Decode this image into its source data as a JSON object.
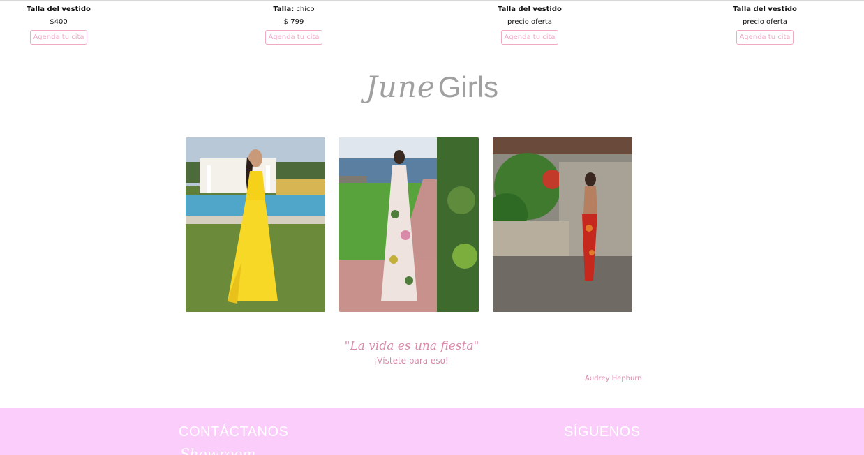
{
  "products": [
    {
      "line1_label": "Talla del vestido",
      "line1_value": "",
      "line2": "$400",
      "cta": "Agenda tu cita"
    },
    {
      "line1_label": "Talla:",
      "line1_value": " chico",
      "line2": "$ 799",
      "cta": "Agenda tu cita"
    },
    {
      "line1_label": "Talla del vestido",
      "line1_value": "",
      "line2": "precio oferta",
      "cta": "Agenda tu cita"
    },
    {
      "line1_label": "Talla del vestido",
      "line1_value": "",
      "line2": "precio oferta",
      "cta": "Agenda tu cita"
    }
  ],
  "brand": {
    "script": "June",
    "plain": "Girls"
  },
  "quote": {
    "text": "\"La vida es una fiesta\"",
    "subtext": "¡Vístete para eso!",
    "author": "Audrey Hepburn"
  },
  "footer": {
    "contact": "CONTÁCTANOS",
    "follow": "SÍGUENOS",
    "showroom": "Showroom"
  },
  "colors": {
    "accent_pink": "#f2a9c4",
    "quote_pink": "#d98aa8",
    "footer_bg": "#fbcdfb",
    "brand_gray": "#a0a0a0"
  }
}
